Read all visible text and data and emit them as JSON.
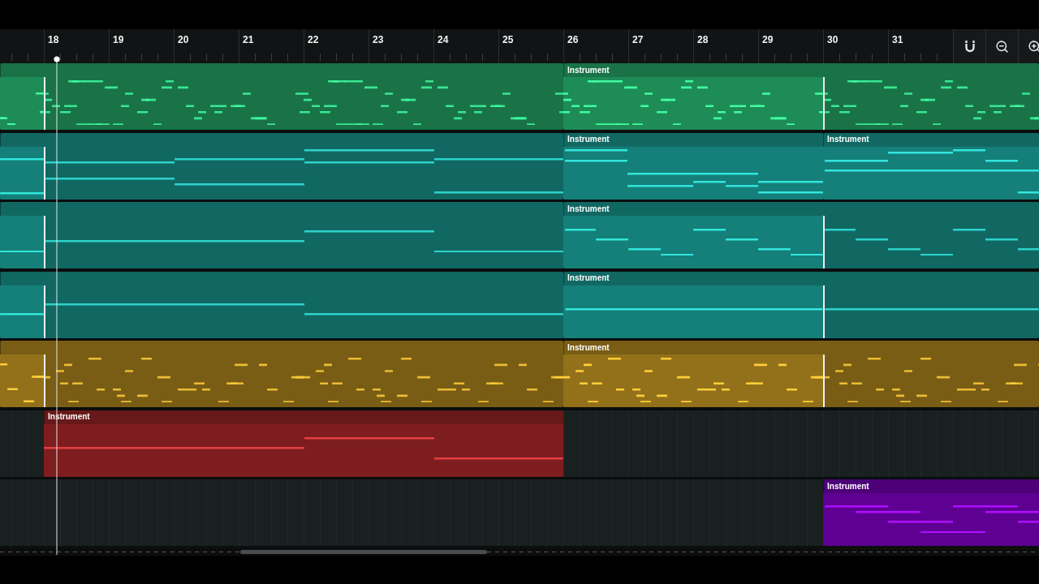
{
  "ruler": {
    "bars": [
      "18",
      "19",
      "20",
      "21",
      "22",
      "23",
      "24",
      "25",
      "26",
      "27",
      "28",
      "29",
      "30",
      "31"
    ]
  },
  "lanes": [
    {
      "color": "#1e8c56",
      "clips": [
        {
          "looped": true
        },
        {
          "label": "Instrument",
          "looped": true
        }
      ]
    },
    {
      "color": "#157f79",
      "clips": [
        {
          "looped": true
        },
        {
          "label": "Instrument",
          "looped": false
        },
        {
          "label": "Instrument"
        }
      ]
    },
    {
      "color": "#157f79",
      "clips": [
        {
          "looped": true
        },
        {
          "label": "Instrument",
          "looped": true
        }
      ]
    },
    {
      "color": "#157f79",
      "clips": [
        {
          "looped": true
        },
        {
          "label": "Instrument",
          "looped": true
        }
      ]
    },
    {
      "color": "#93711a",
      "clips": [
        {
          "looped": true
        },
        {
          "label": "Instrument",
          "looped": true
        }
      ]
    },
    {
      "color": "#7e1d1f",
      "clips": [
        {
          "label": "Instrument",
          "looped": false
        }
      ]
    },
    {
      "color": "#5e0092",
      "clips": [
        {
          "label": "Instrument"
        }
      ]
    }
  ]
}
